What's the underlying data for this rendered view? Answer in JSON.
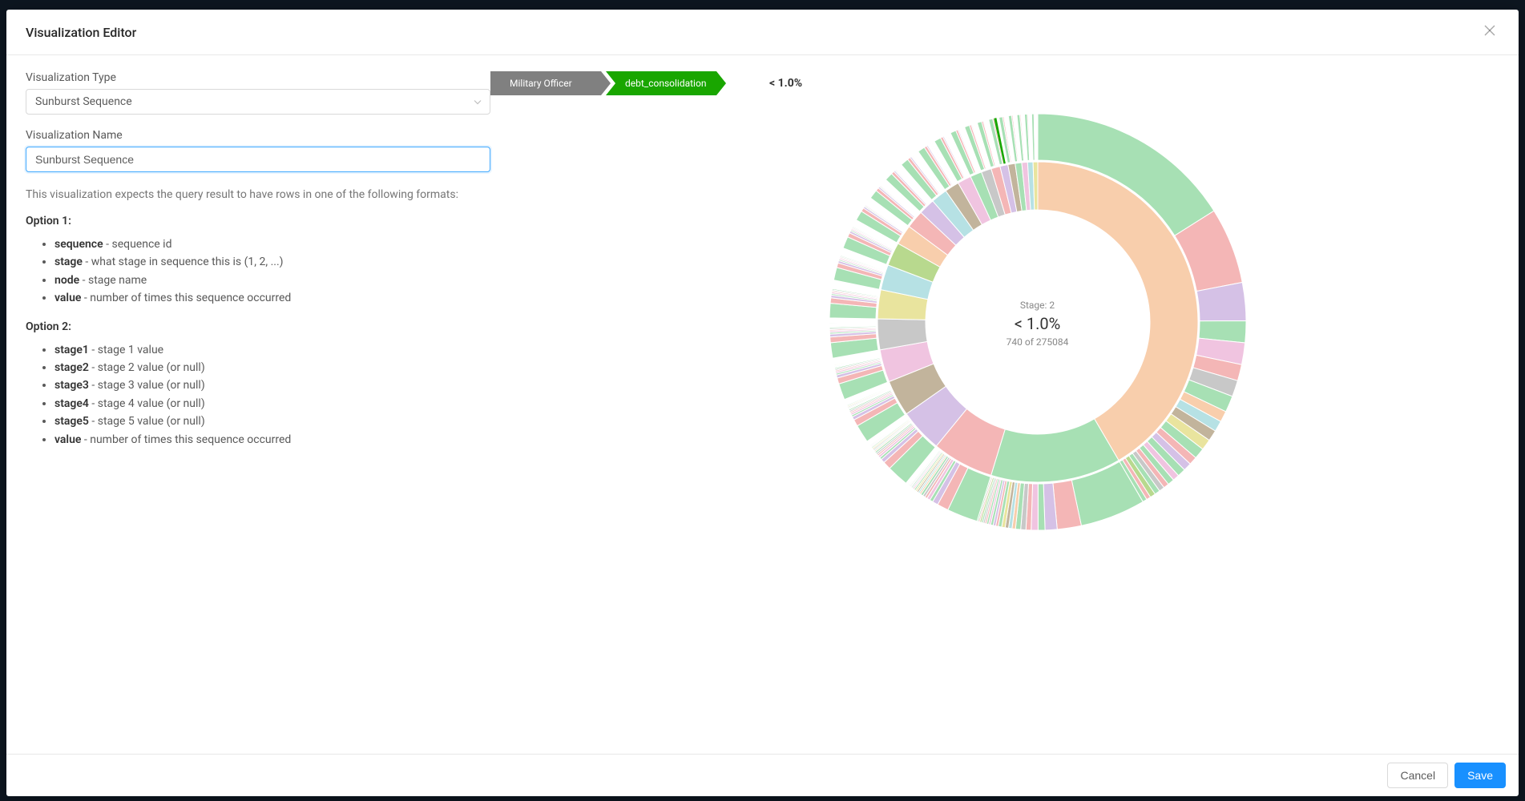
{
  "modal": {
    "title": "Visualization Editor",
    "close_label": "×"
  },
  "form": {
    "type_label": "Visualization Type",
    "type_value": "Sunburst Sequence",
    "name_label": "Visualization Name",
    "name_value": "Sunburst Sequence",
    "help_text": "This visualization expects the query result to have rows in one of the following formats:",
    "option1_heading": "Option 1:",
    "option1": [
      {
        "col": "sequence",
        "desc": " - sequence id"
      },
      {
        "col": "stage",
        "desc": " - what stage in sequence this is (1, 2, ...)"
      },
      {
        "col": "node",
        "desc": " - stage name"
      },
      {
        "col": "value",
        "desc": " - number of times this sequence occurred"
      }
    ],
    "option2_heading": "Option 2:",
    "option2": [
      {
        "col": "stage1",
        "desc": " - stage 1 value"
      },
      {
        "col": "stage2",
        "desc": " - stage 2 value (or null)"
      },
      {
        "col": "stage3",
        "desc": " - stage 3 value (or null)"
      },
      {
        "col": "stage4",
        "desc": " - stage 4 value (or null)"
      },
      {
        "col": "stage5",
        "desc": " - stage 5 value (or null)"
      },
      {
        "col": "value",
        "desc": " - number of times this sequence occurred"
      }
    ]
  },
  "trail": {
    "crumbs": [
      {
        "label": "Military Officer",
        "color": "#808080"
      },
      {
        "label": "debt_consolidation",
        "color": "#19a600"
      }
    ],
    "percent": "< 1.0%"
  },
  "center": {
    "stage_label": "Stage: 2",
    "percent": "< 1.0%",
    "count_text": "740 of 275084"
  },
  "buttons": {
    "cancel": "Cancel",
    "save": "Save"
  },
  "chart_data": {
    "type": "sunburst",
    "total": 275084,
    "highlight": {
      "path": [
        "Military Officer",
        "debt_consolidation"
      ],
      "value": 740,
      "percent": "< 1.0%"
    },
    "palette": [
      "#a7e0b4",
      "#f8ceac",
      "#f4b6b6",
      "#d5c1e6",
      "#c2b49c",
      "#f0c4e0",
      "#c8c8c8",
      "#e9e49e",
      "#b6e1e4",
      "#b8d98e"
    ],
    "rings": 2,
    "inner": [
      {
        "value": 114000,
        "color": "#f8ceac"
      },
      {
        "value": 36000,
        "color": "#a7e0b4"
      },
      {
        "value": 17000,
        "color": "#f4b6b6"
      },
      {
        "value": 12000,
        "color": "#d5c1e6"
      },
      {
        "value": 10000,
        "color": "#c2b49c"
      },
      {
        "value": 9000,
        "color": "#f0c4e0"
      },
      {
        "value": 8500,
        "color": "#c8c8c8"
      },
      {
        "value": 8000,
        "color": "#e9e49e"
      },
      {
        "value": 7000,
        "color": "#b6e1e4"
      },
      {
        "value": 6500,
        "color": "#b8d98e"
      },
      {
        "value": 5500,
        "color": "#f8ceac"
      },
      {
        "value": 5000,
        "color": "#f4b6b6"
      },
      {
        "value": 4500,
        "color": "#d5c1e6"
      },
      {
        "value": 4500,
        "color": "#b6e1e4"
      },
      {
        "value": 4000,
        "color": "#c2b49c"
      },
      {
        "value": 3800,
        "color": "#f0c4e0"
      },
      {
        "value": 3200,
        "color": "#a7e0b4"
      },
      {
        "value": 2800,
        "color": "#c8c8c8"
      },
      {
        "value": 2500,
        "color": "#f4b6b6"
      },
      {
        "value": 2200,
        "color": "#d5c1e6"
      },
      {
        "value": 2000,
        "color": "#c2b49c"
      },
      {
        "value": 1800,
        "color": "#a7e0b4"
      },
      {
        "value": 1600,
        "color": "#f0c4e0"
      },
      {
        "value": 1500,
        "color": "#b6e1e4"
      },
      {
        "value": 1284,
        "color": "#e9e49e"
      }
    ],
    "outer_pattern": [
      {
        "weight": 0.38,
        "color": "#a7e0b4"
      },
      {
        "weight": 0.14,
        "color": "#f4b6b6"
      },
      {
        "weight": 0.07,
        "color": "#d5c1e6"
      },
      {
        "weight": 0.04,
        "color": "#a7e0b4"
      },
      {
        "weight": 0.04,
        "color": "#f0c4e0"
      },
      {
        "weight": 0.03,
        "color": "#f4b6b6"
      },
      {
        "weight": 0.03,
        "color": "#c8c8c8"
      },
      {
        "weight": 0.03,
        "color": "#a7e0b4"
      },
      {
        "weight": 0.02,
        "color": "#f8ceac"
      },
      {
        "weight": 0.02,
        "color": "#b6e1e4"
      },
      {
        "weight": 0.02,
        "color": "#c2b49c"
      },
      {
        "weight": 0.02,
        "color": "#e9e49e"
      },
      {
        "weight": 0.02,
        "color": "#a7e0b4"
      },
      {
        "weight": 0.015,
        "color": "#f4b6b6"
      },
      {
        "weight": 0.015,
        "color": "#d5c1e6"
      },
      {
        "weight": 0.015,
        "color": "#a7e0b4"
      },
      {
        "weight": 0.012,
        "color": "#f0c4e0"
      },
      {
        "weight": 0.012,
        "color": "#a7e0b4"
      },
      {
        "weight": 0.01,
        "color": "#f4b6b6"
      },
      {
        "weight": 0.01,
        "color": "#c8c8c8"
      },
      {
        "weight": 0.01,
        "color": "#a7e0b4"
      },
      {
        "weight": 0.01,
        "color": "#b8d98e"
      },
      {
        "weight": 0.008,
        "color": "#f4b6b6"
      },
      {
        "weight": 0.008,
        "color": "#a7e0b4"
      }
    ],
    "outer_tail_highlight": {
      "color": "#19a600",
      "weight": 0.003
    }
  }
}
